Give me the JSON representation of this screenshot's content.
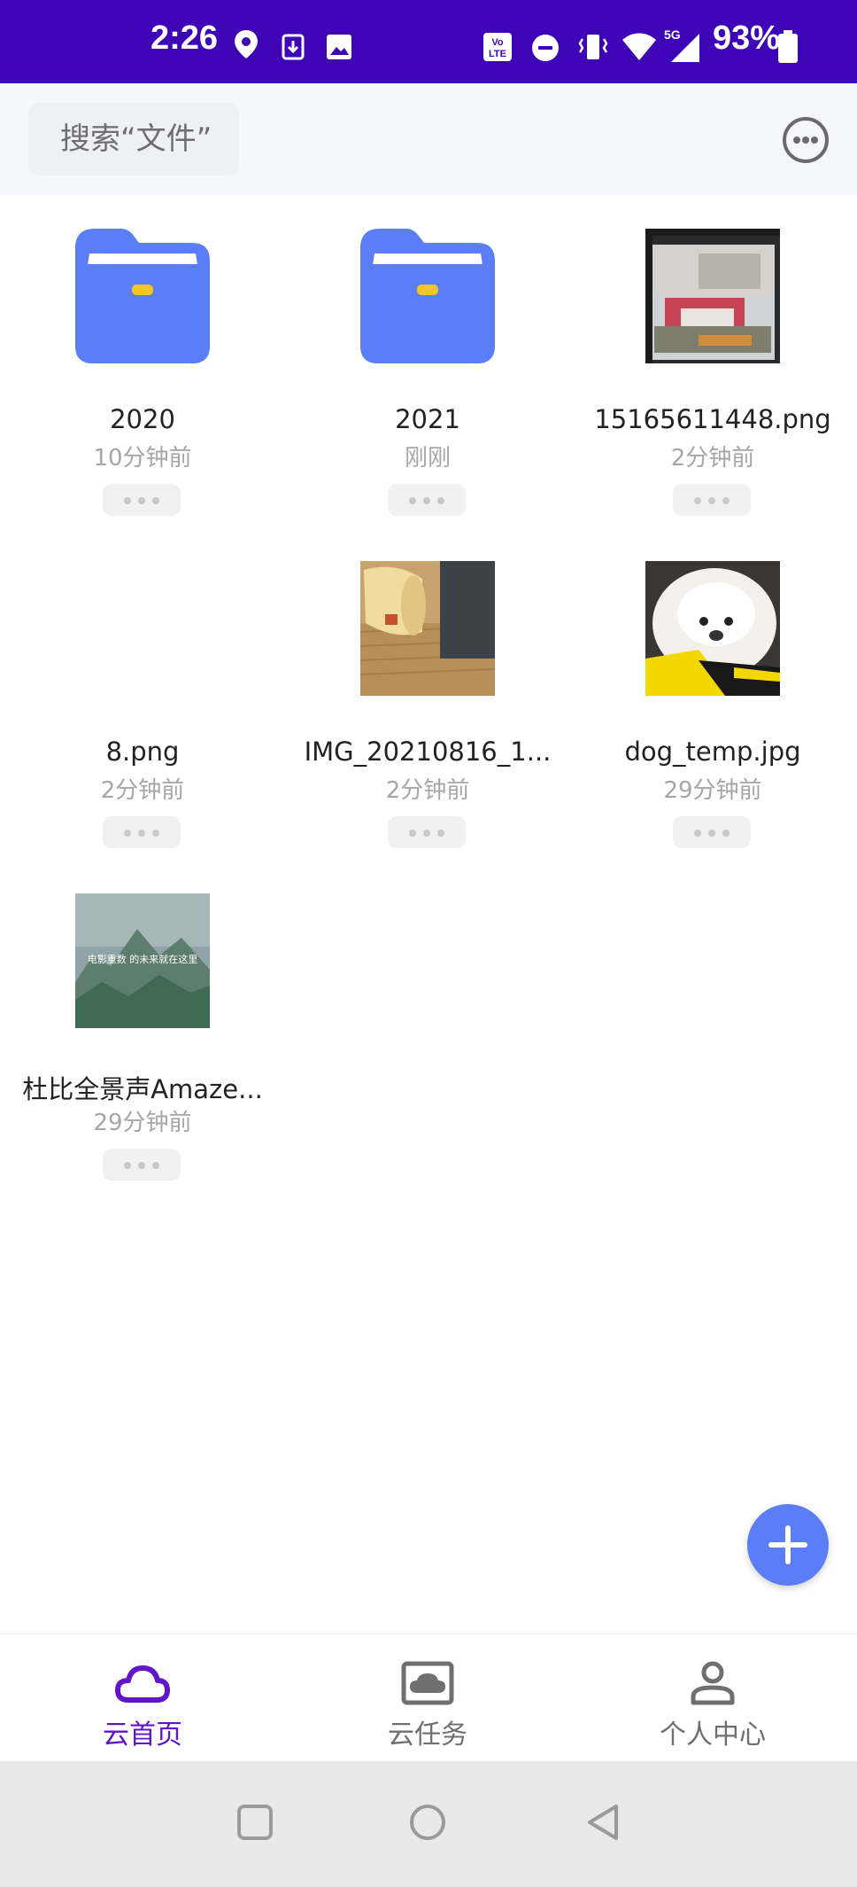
{
  "status_bar": {
    "time": "2:26",
    "battery": "93%",
    "icons": [
      "location-icon",
      "download-icon",
      "image-icon",
      "volte-icon",
      "dnd-icon",
      "vibrate-icon",
      "wifi-icon",
      "signal-5g-icon",
      "battery-icon"
    ]
  },
  "search": {
    "placeholder": "搜索“文件”"
  },
  "files": [
    {
      "name": "2020",
      "time": "10分钟前",
      "type": "folder"
    },
    {
      "name": "2021",
      "time": "刚刚",
      "type": "folder"
    },
    {
      "name": "15165611448.png",
      "time": "2分钟前",
      "type": "image"
    },
    {
      "name": "8.png",
      "time": "2分钟前",
      "type": "blank-image"
    },
    {
      "name": "IMG_20210816_1...",
      "time": "2分钟前",
      "type": "image"
    },
    {
      "name": "dog_temp.jpg",
      "time": "29分钟前",
      "type": "image"
    },
    {
      "name": "杜比全景声Amaze...",
      "time": "29分钟前",
      "type": "image",
      "thumb_caption": "电影重数 的未来就在这里"
    }
  ],
  "bottom_nav": [
    {
      "label": "云首页",
      "icon": "cloud-icon",
      "active": true
    },
    {
      "label": "云任务",
      "icon": "task-icon",
      "active": false
    },
    {
      "label": "个人中心",
      "icon": "person-icon",
      "active": false
    }
  ],
  "colors": {
    "status_bar": "#3d05b5",
    "accent": "#6114c9",
    "folder": "#5b7ef6",
    "fab": "#5b7ef6"
  }
}
